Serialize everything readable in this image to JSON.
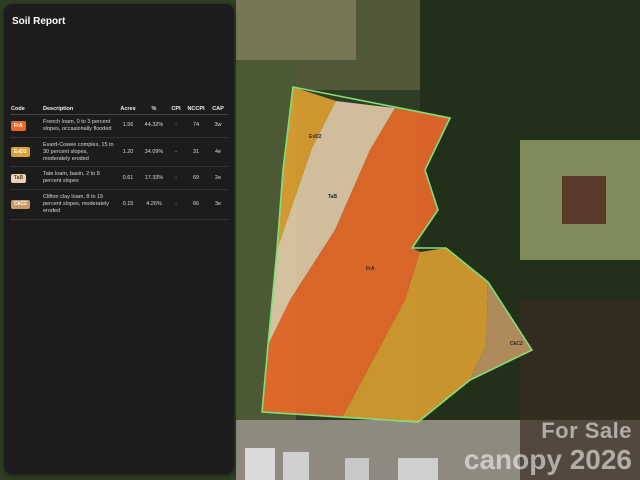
{
  "panel": {
    "title": "Soil Report",
    "columns": [
      "Code",
      "Description",
      "Acres",
      "%",
      "CPI",
      "NCCPI",
      "CAP"
    ],
    "rows": [
      {
        "code": "FrA",
        "color": "#e8692a",
        "description": "French loam, 0 to 3 percent slopes, occasionally flooded",
        "acres": "1.56",
        "pct": "44.32%",
        "cpi": "-",
        "nccpi": "74",
        "cap": "3w"
      },
      {
        "code": "EvD2",
        "color": "#e0a030",
        "description": "Evard-Cowee complex, 15 to 30 percent slopes, moderately eroded",
        "acres": "1.20",
        "pct": "34.09%",
        "cpi": "-",
        "nccpi": "31",
        "cap": "4e"
      },
      {
        "code": "TaB",
        "color": "#ecd4b0",
        "description": "Tate loam, basin, 2 to 8 percent slopes",
        "acres": "0.61",
        "pct": "17.33%",
        "cpi": "-",
        "nccpi": "69",
        "cap": "2e"
      },
      {
        "code": "CkC2",
        "color": "#c89a66",
        "description": "Clifton clay loam, 8 to 15 percent slopes, moderately eroded",
        "acres": "0.15",
        "pct": "4.26%",
        "cpi": "-",
        "nccpi": "66",
        "cap": "3e"
      }
    ]
  },
  "map": {
    "labels": {
      "evd2": "EvD2",
      "tab": "TaB",
      "fra": "FrA",
      "ckc2": "CkC2"
    },
    "outline_color": "#7fe07a"
  },
  "watermark": {
    "line1": "For Sale",
    "line2": "canopy 2026"
  }
}
